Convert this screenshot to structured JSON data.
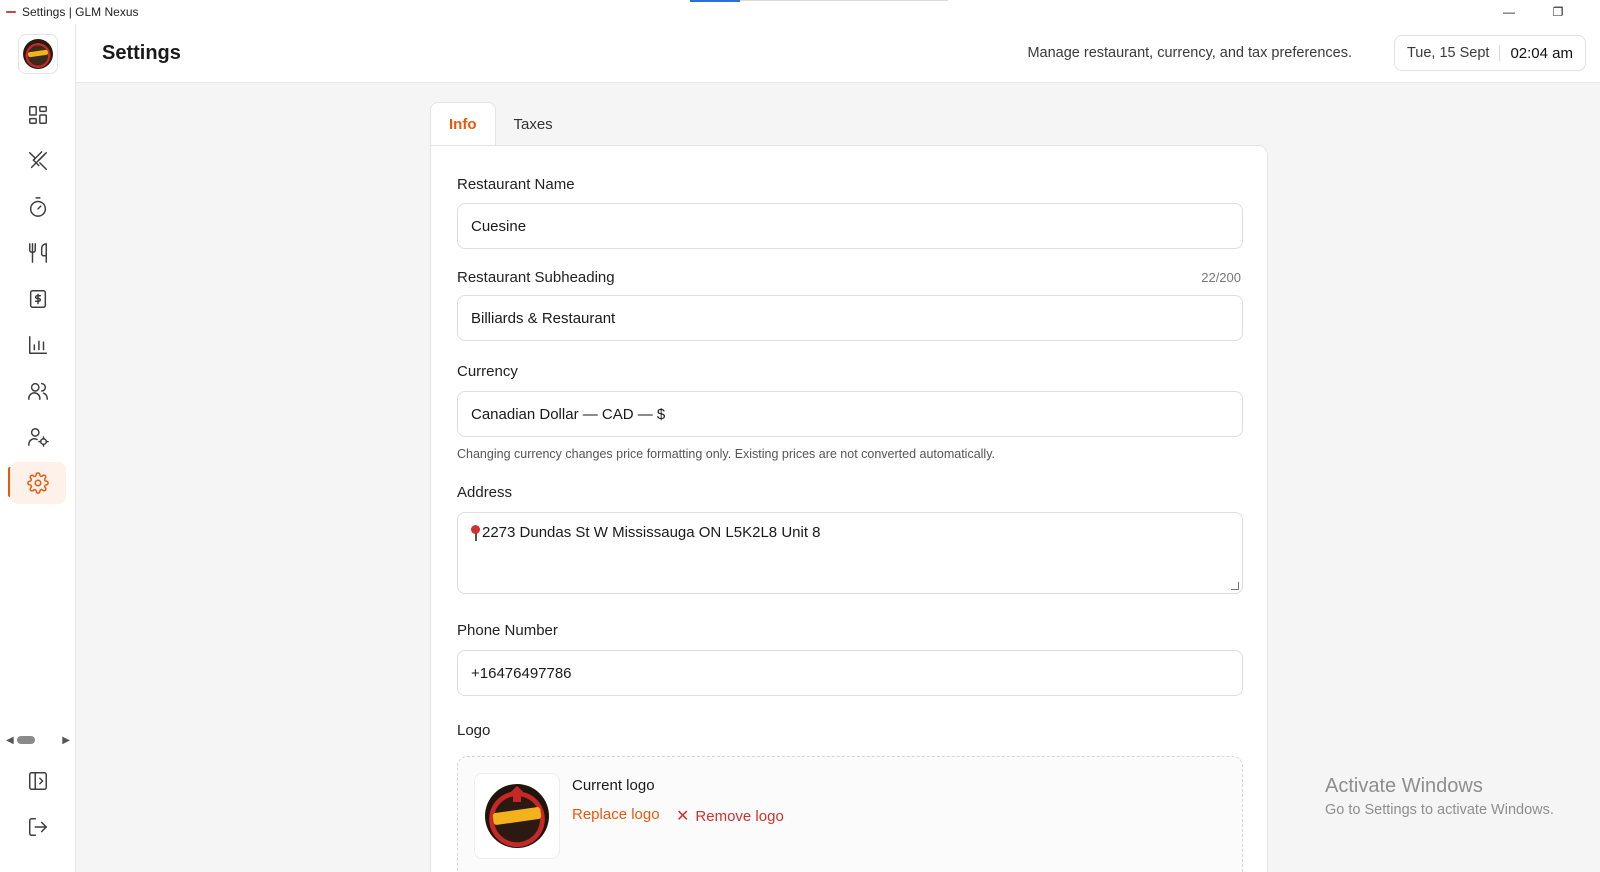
{
  "window": {
    "title": "Settings | GLM Nexus",
    "minimize_symbol": "—",
    "restore_symbol": "❐"
  },
  "header": {
    "title": "Settings",
    "subtitle": "Manage restaurant, currency, and tax preferences.",
    "date": "Tue, 15 Sept",
    "time": "02:04 am"
  },
  "sidebar": {
    "items": [
      {
        "icon": "dashboard-icon"
      },
      {
        "icon": "utensils-crossed-icon"
      },
      {
        "icon": "timer-icon"
      },
      {
        "icon": "fork-knife-icon"
      },
      {
        "icon": "receipt-dollar-icon"
      },
      {
        "icon": "bar-chart-icon"
      },
      {
        "icon": "users-icon"
      },
      {
        "icon": "user-cog-icon"
      },
      {
        "icon": "gear-icon",
        "active": true
      }
    ],
    "bottom": [
      {
        "icon": "panel-toggle-icon"
      },
      {
        "icon": "logout-icon"
      }
    ],
    "accent": "#e8590c"
  },
  "tabs": [
    {
      "label": "Info",
      "active": true
    },
    {
      "label": "Taxes",
      "active": false
    }
  ],
  "form": {
    "restaurant_name": {
      "label": "Restaurant Name",
      "value": "Cuesine"
    },
    "subheading": {
      "label": "Restaurant Subheading",
      "value": "Billiards & Restaurant",
      "counter": "22/200"
    },
    "currency": {
      "label": "Currency",
      "value": "Canadian Dollar — CAD — $",
      "helper": "Changing currency changes price formatting only. Existing prices are not converted automatically."
    },
    "address": {
      "label": "Address",
      "value": "2273 Dundas St W Mississauga ON L5K2L8 Unit 8"
    },
    "phone": {
      "label": "Phone Number",
      "value": "+16476497786"
    },
    "logo": {
      "label": "Logo",
      "current_label": "Current logo",
      "replace_label": "Replace logo",
      "remove_label": "Remove logo",
      "remove_symbol": "✕"
    }
  },
  "watermark": {
    "line1": "Activate Windows",
    "line2": "Go to Settings to activate Windows."
  }
}
